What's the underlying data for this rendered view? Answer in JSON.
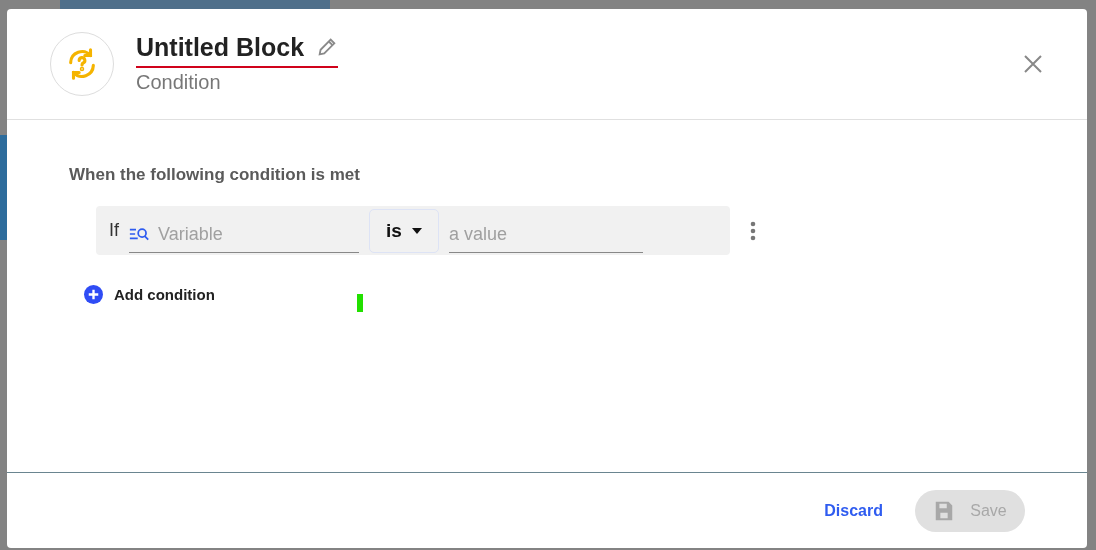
{
  "dialog": {
    "title": "Untitled Block",
    "subtitle": "Condition",
    "title_invalid": true
  },
  "body": {
    "heading": "When the following condition is met",
    "conditions": [
      {
        "prefix": "If",
        "variable": {
          "placeholder": "Variable"
        },
        "operator": "is",
        "value": {
          "placeholder": "a value"
        }
      }
    ],
    "add_condition": "Add condition"
  },
  "footer": {
    "discard": "Discard",
    "save": {
      "label": "Save",
      "disabled": true
    }
  }
}
